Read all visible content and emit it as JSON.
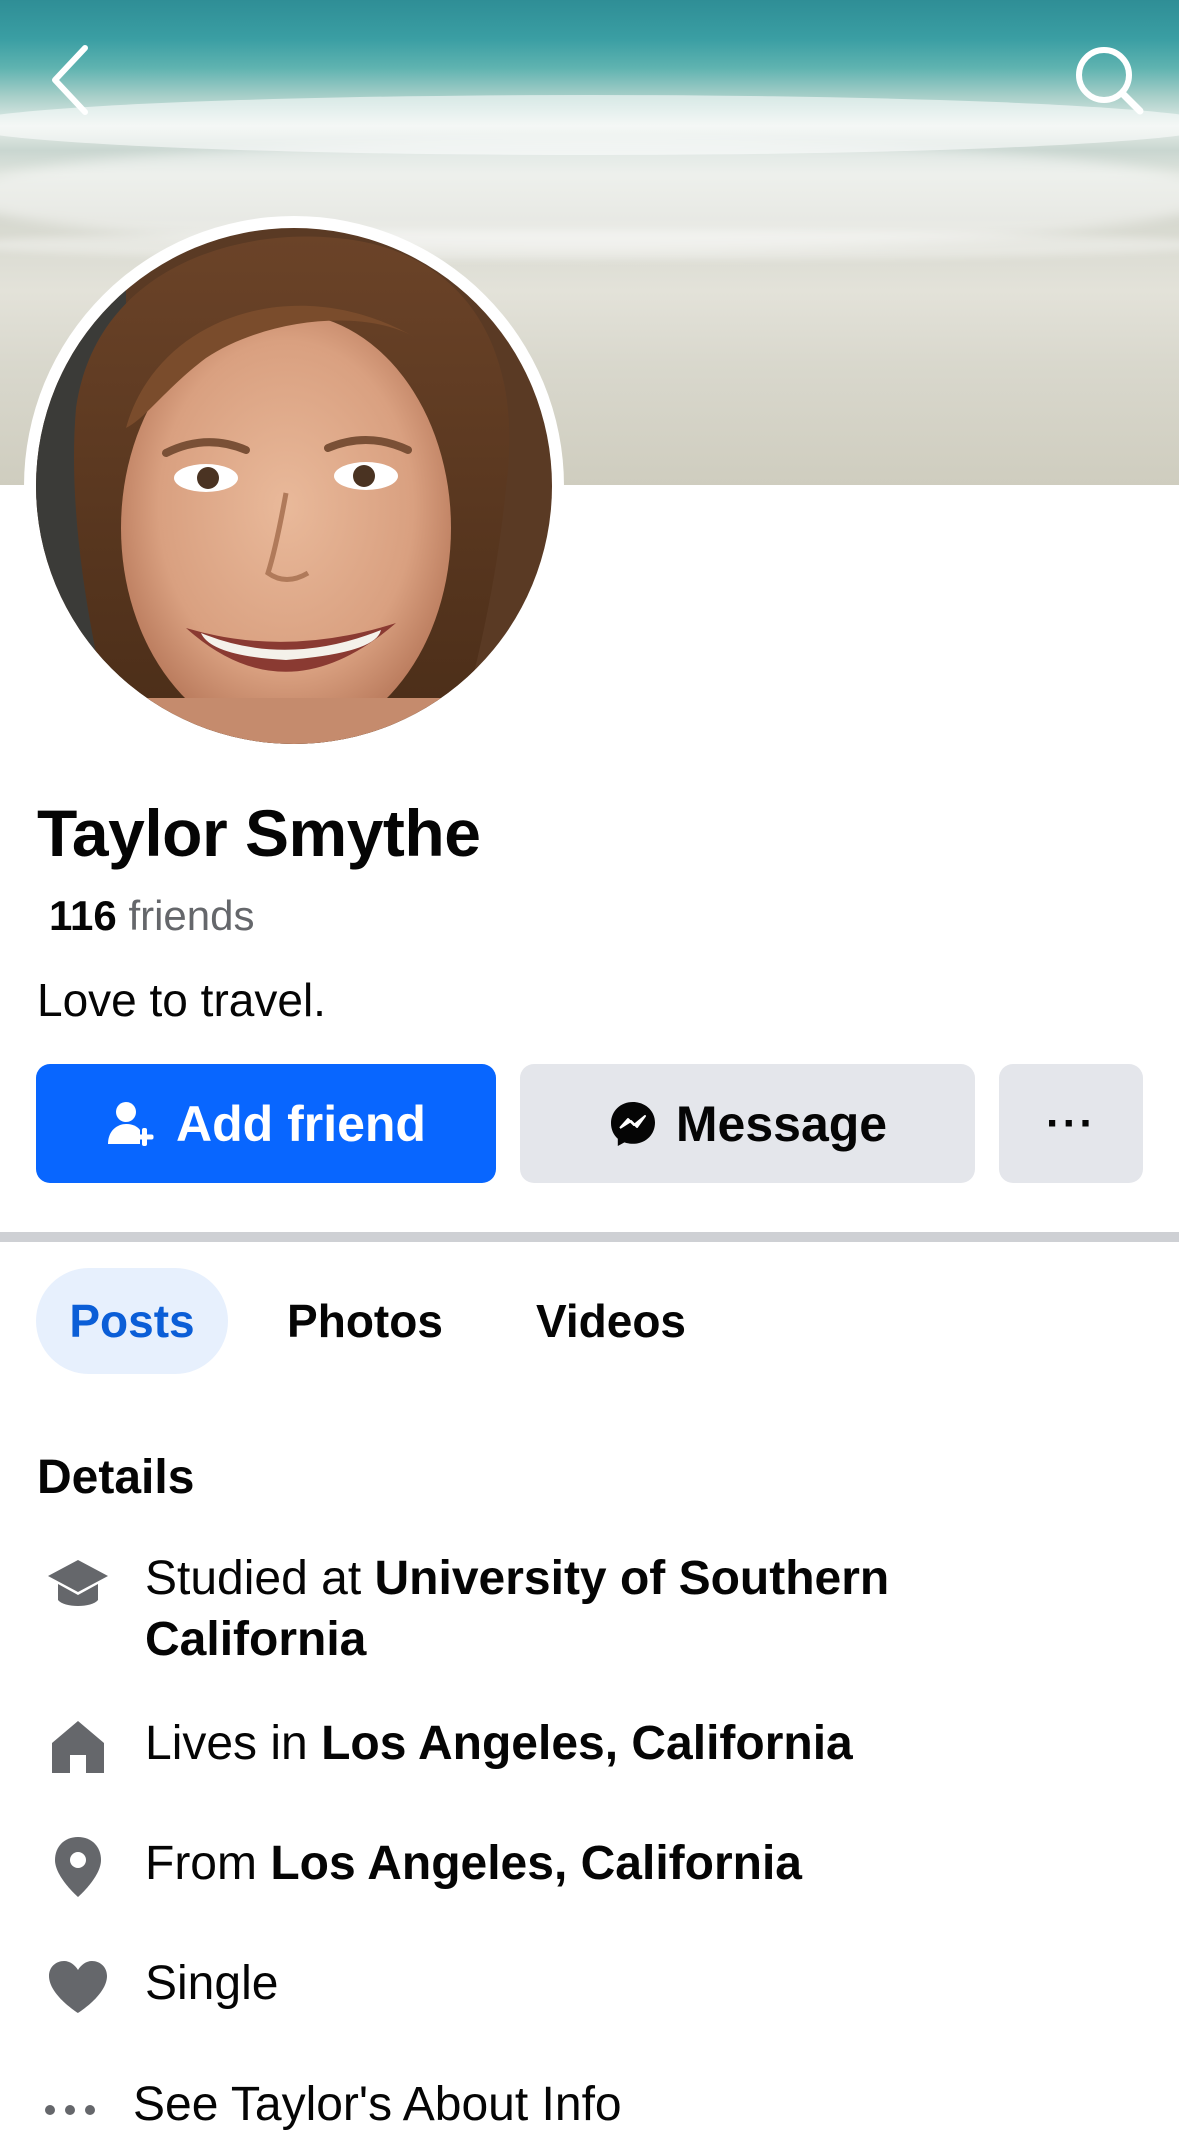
{
  "header": {
    "back_icon": "chevron-left-icon",
    "search_icon": "search-icon"
  },
  "profile": {
    "name": "Taylor Smythe",
    "friends_count": "116",
    "friends_label": "friends",
    "bio": "Love to travel."
  },
  "actions": {
    "add_friend_label": "Add friend",
    "message_label": "Message",
    "more_label": "···",
    "add_friend_color": "#0866ff",
    "secondary_color": "#e4e6eb"
  },
  "tabs": [
    {
      "label": "Posts",
      "active": true
    },
    {
      "label": "Photos",
      "active": false
    },
    {
      "label": "Videos",
      "active": false
    }
  ],
  "details": {
    "title": "Details",
    "items": [
      {
        "icon": "graduation-cap-icon",
        "prefix": "Studied at",
        "value": "University of Southern California"
      },
      {
        "icon": "home-icon",
        "prefix": "Lives in",
        "value": "Los Angeles, California"
      },
      {
        "icon": "location-pin-icon",
        "prefix": "From",
        "value": "Los Angeles, California"
      },
      {
        "icon": "heart-icon",
        "prefix": "",
        "value": "Single"
      }
    ],
    "about_link": "See Taylor's About Info"
  }
}
